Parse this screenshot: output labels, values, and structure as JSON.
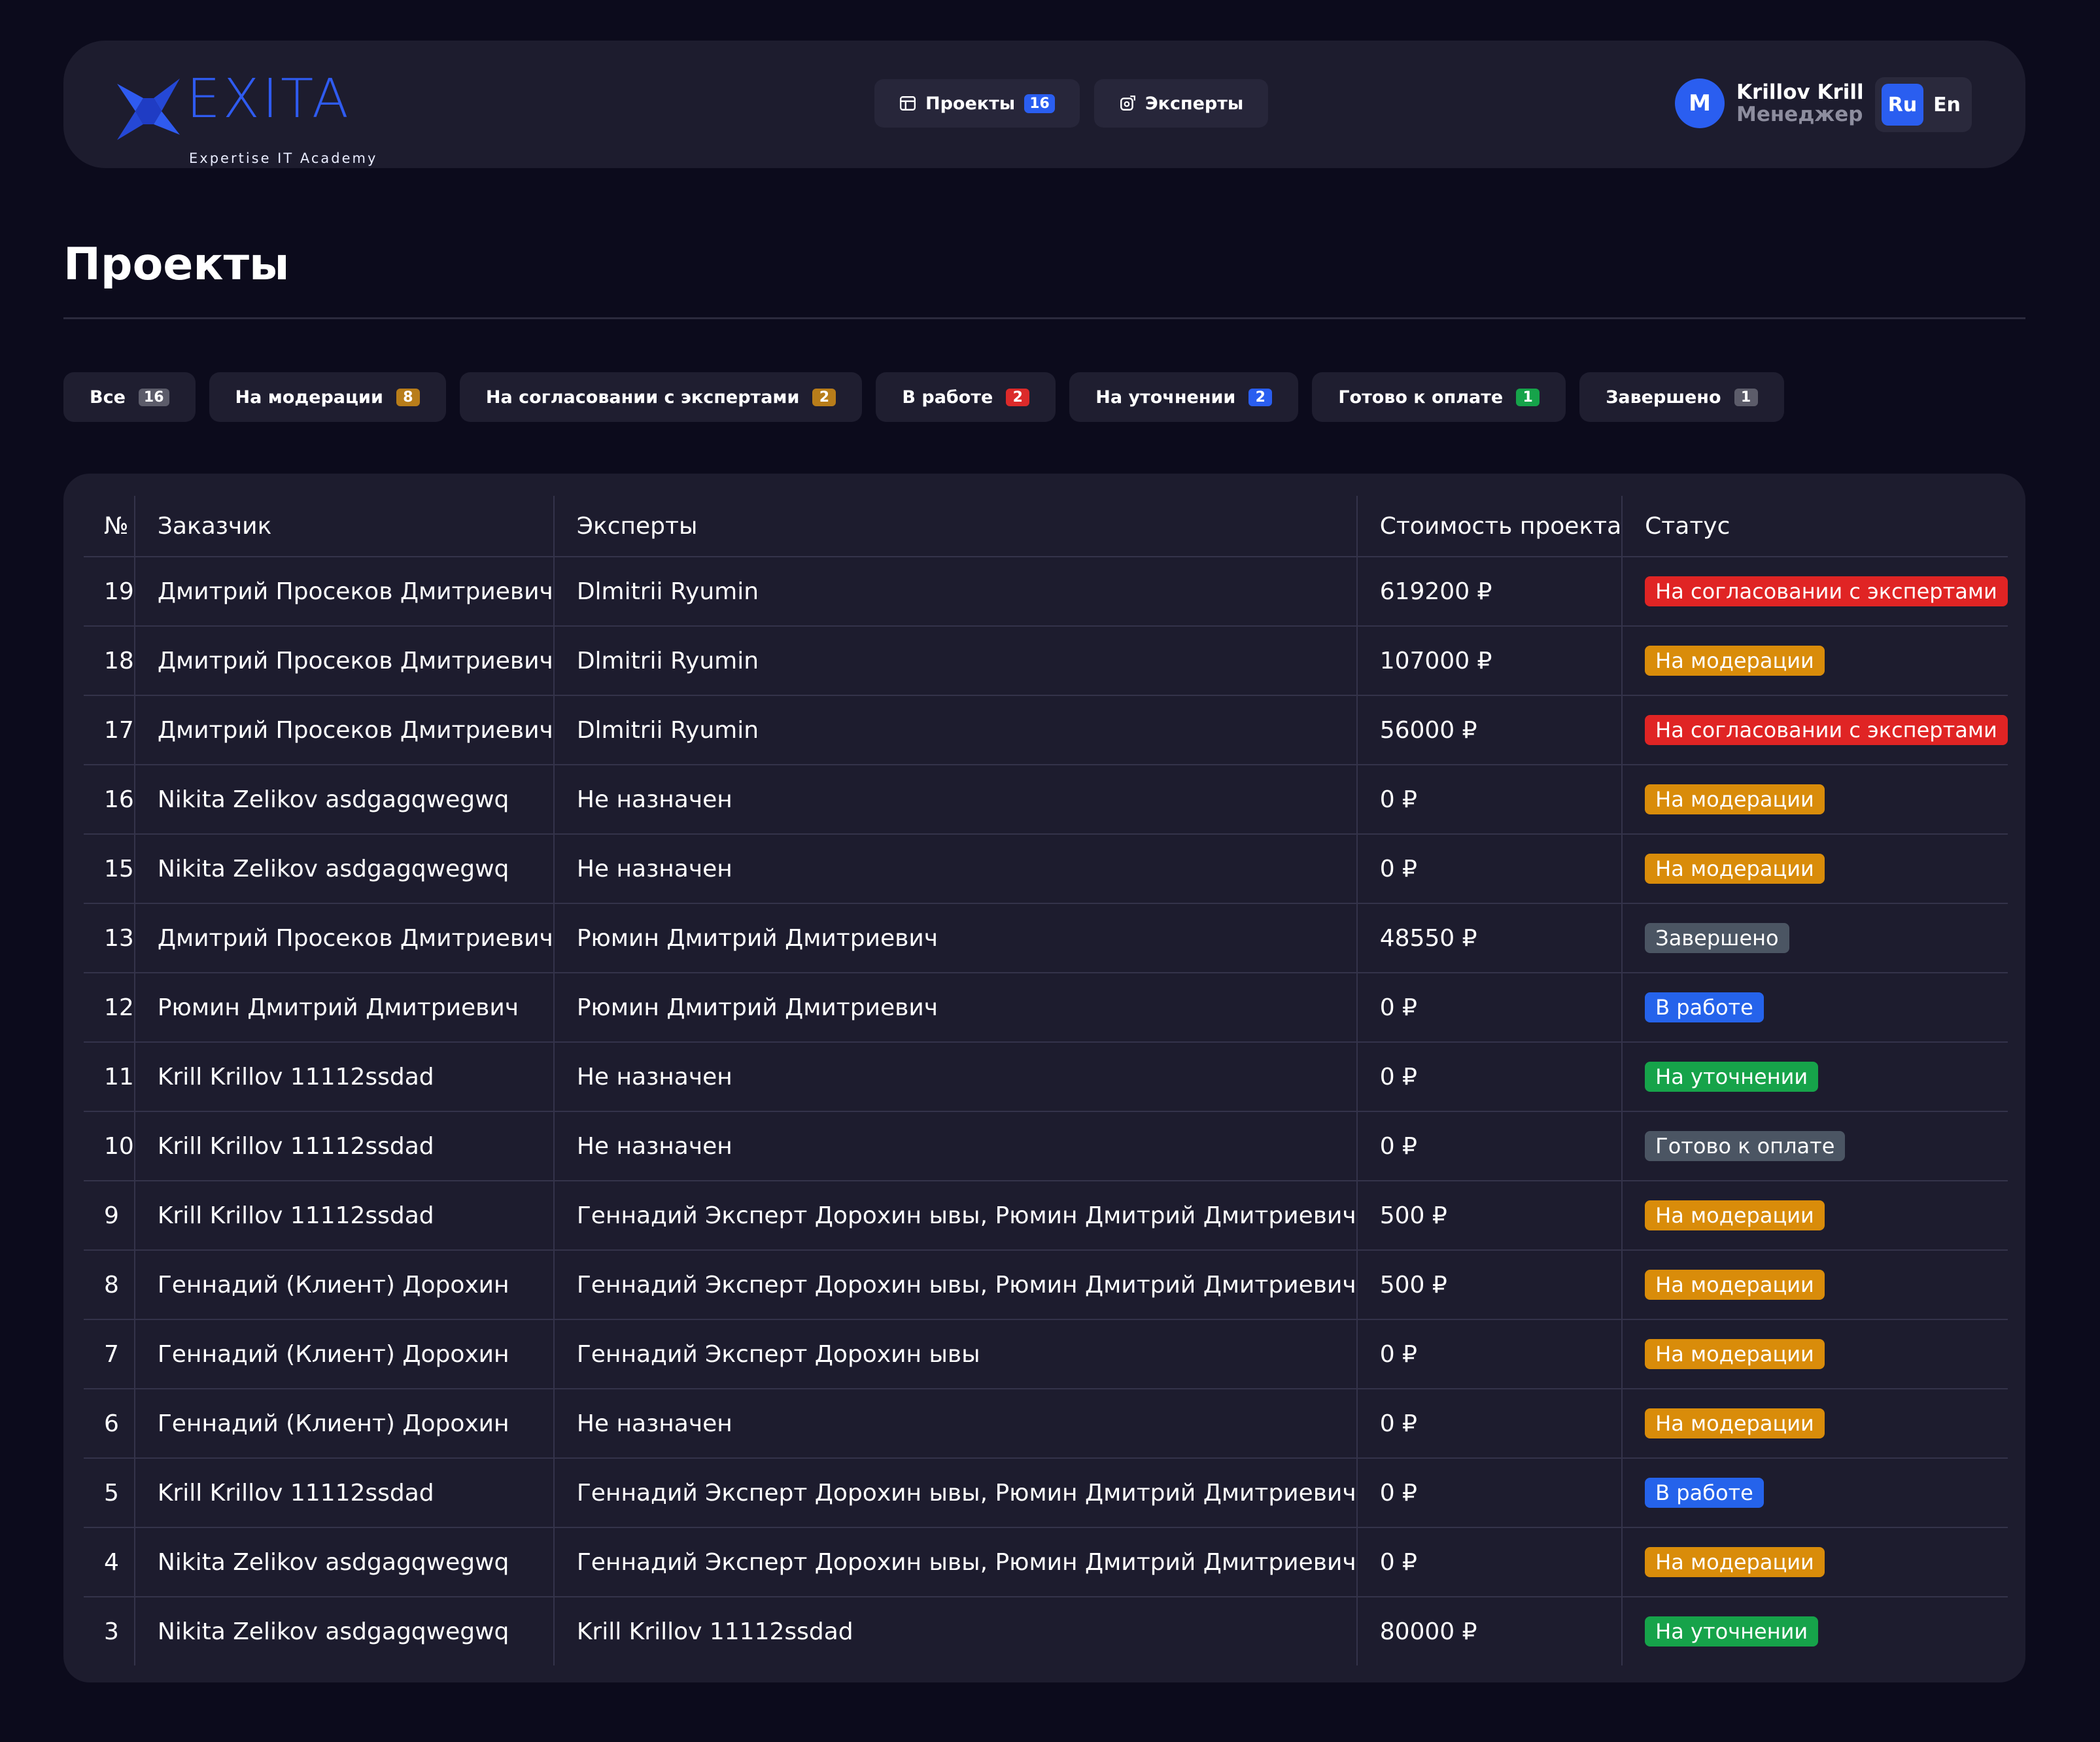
{
  "logo": {
    "name": "EXITA",
    "tagline": "Expertise IT Academy"
  },
  "nav": [
    {
      "label": "Проекты",
      "badge": "16",
      "icon": "table-icon"
    },
    {
      "label": "Эксперты",
      "icon": "experts-icon"
    }
  ],
  "user": {
    "avatar_letter": "M",
    "name": "Krillov Krill",
    "role": "Менеджер"
  },
  "lang": {
    "ru": "Ru",
    "en": "En",
    "active": "Ru"
  },
  "page_title": "Проекты",
  "filters": [
    {
      "label": "Все",
      "count": "16",
      "color": "#5c5c6a"
    },
    {
      "label": "На модерации",
      "count": "8",
      "color": "#b87d1a"
    },
    {
      "label": "На согласовании с экспертами",
      "count": "2",
      "color": "#b87d1a"
    },
    {
      "label": "В работе",
      "count": "2",
      "color": "#dc2a2a"
    },
    {
      "label": "На уточнении",
      "count": "2",
      "color": "#2a5ef0"
    },
    {
      "label": "Готово к оплате",
      "count": "1",
      "color": "#16a34a"
    },
    {
      "label": "Завершено",
      "count": "1",
      "color": "#5c5c6a"
    }
  ],
  "table": {
    "columns": [
      "№",
      "Заказчик",
      "Эксперты",
      "Стоимость проекта",
      "Статус"
    ],
    "rows": [
      {
        "id": "19",
        "client": "Дмитрий Просеков Дмитриевич",
        "experts": "Dlmitrii Ryumin",
        "cost": "619200 ₽",
        "status": "На согласовании с экспертами",
        "status_color": "#e02424"
      },
      {
        "id": "18",
        "client": "Дмитрий Просеков Дмитриевич",
        "experts": "Dlmitrii Ryumin",
        "cost": "107000 ₽",
        "status": "На модерации",
        "status_color": "#d98c0a"
      },
      {
        "id": "17",
        "client": "Дмитрий Просеков Дмитриевич",
        "experts": "Dlmitrii Ryumin",
        "cost": "56000 ₽",
        "status": "На согласовании с экспертами",
        "status_color": "#e02424"
      },
      {
        "id": "16",
        "client": "Nikita Zelikov asdgagqwegwq",
        "experts": "Не назначен",
        "cost": "0 ₽",
        "status": "На модерации",
        "status_color": "#d98c0a"
      },
      {
        "id": "15",
        "client": "Nikita Zelikov asdgagqwegwq",
        "experts": "Не назначен",
        "cost": "0 ₽",
        "status": "На модерации",
        "status_color": "#d98c0a"
      },
      {
        "id": "13",
        "client": "Дмитрий Просеков Дмитриевич",
        "experts": "Рюмин Дмитрий Дмитриевич",
        "cost": "48550 ₽",
        "status": "Завершено",
        "status_color": "#4b5563"
      },
      {
        "id": "12",
        "client": "Рюмин Дмитрий Дмитриевич",
        "experts": "Рюмин Дмитрий Дмитриевич",
        "cost": "0 ₽",
        "status": "В работе",
        "status_color": "#2563eb"
      },
      {
        "id": "11",
        "client": "Krill Krillov 11112ssdad",
        "experts": "Не назначен",
        "cost": "0 ₽",
        "status": "На уточнении",
        "status_color": "#16a34a"
      },
      {
        "id": "10",
        "client": "Krill Krillov 11112ssdad",
        "experts": "Не назначен",
        "cost": "0 ₽",
        "status": "Готово к оплате",
        "status_color": "#4b5563"
      },
      {
        "id": "9",
        "client": "Krill Krillov 11112ssdad",
        "experts": "Геннадий Эксперт Дорохин ывы, Рюмин Дмитрий Дмитриевич",
        "cost": "500 ₽",
        "status": "На модерации",
        "status_color": "#d98c0a"
      },
      {
        "id": "8",
        "client": "Геннадий (Клиент) Дорохин",
        "experts": "Геннадий Эксперт Дорохин ывы, Рюмин Дмитрий Дмитриевич",
        "cost": "500 ₽",
        "status": "На модерации",
        "status_color": "#d98c0a"
      },
      {
        "id": "7",
        "client": "Геннадий (Клиент) Дорохин",
        "experts": "Геннадий Эксперт Дорохин ывы",
        "cost": "0 ₽",
        "status": "На модерации",
        "status_color": "#d98c0a"
      },
      {
        "id": "6",
        "client": "Геннадий (Клиент) Дорохин",
        "experts": "Не назначен",
        "cost": "0 ₽",
        "status": "На модерации",
        "status_color": "#d98c0a"
      },
      {
        "id": "5",
        "client": "Krill Krillov 11112ssdad",
        "experts": "Геннадий Эксперт Дорохин ывы, Рюмин Дмитрий Дмитриевич",
        "cost": "0 ₽",
        "status": "В работе",
        "status_color": "#2563eb"
      },
      {
        "id": "4",
        "client": "Nikita Zelikov asdgagqwegwq",
        "experts": "Геннадий Эксперт Дорохин ывы, Рюмин Дмитрий Дмитриевич",
        "cost": "0 ₽",
        "status": "На модерации",
        "status_color": "#d98c0a"
      },
      {
        "id": "3",
        "client": "Nikita Zelikov asdgagqwegwq",
        "experts": "Krill Krillov 11112ssdad",
        "cost": "80000 ₽",
        "status": "На уточнении",
        "status_color": "#16a34a"
      }
    ]
  }
}
